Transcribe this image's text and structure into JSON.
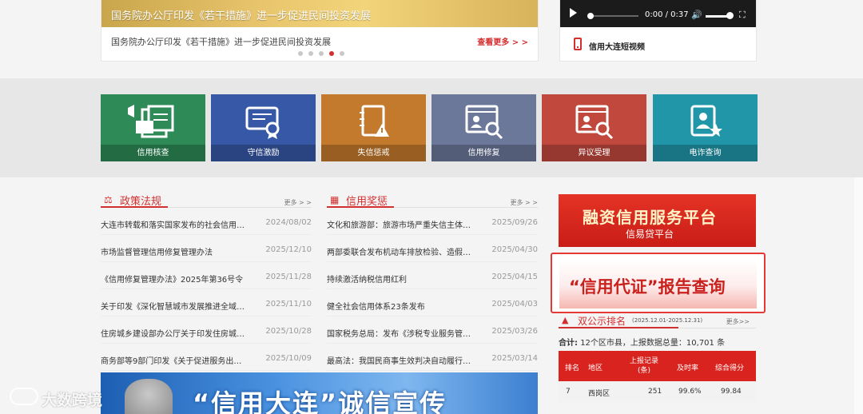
{
  "news": {
    "banner_text": "国务院办公厅印发《若干措施》进一步促进民间投资发展",
    "caption": "国务院办公厅印发《若干措施》进一步促进民间投资发展",
    "more": "查看更多 > >",
    "dots_total": 5,
    "active_dot": 4
  },
  "video": {
    "time": "0:00 / 0:37",
    "label": "信用大连短视频"
  },
  "tiles": [
    {
      "label": "信用核查",
      "color": "#2e8b57",
      "icon": "megaphone-document-icon"
    },
    {
      "label": "守信激励",
      "color": "#3658a6",
      "icon": "certificate-award-icon"
    },
    {
      "label": "失信惩戒",
      "color": "#c47a2c",
      "icon": "notebook-warning-icon"
    },
    {
      "label": "信用修复",
      "color": "#6b789a",
      "icon": "browser-search-user-icon"
    },
    {
      "label": "异议受理",
      "color": "#c0483d",
      "icon": "browser-search-user-icon"
    },
    {
      "label": "电诈查询",
      "color": "#2196a8",
      "icon": "user-document-star-icon"
    }
  ],
  "policy": {
    "title": "政策法规",
    "more": "更多 > >",
    "items": [
      {
        "title": "大连市转载和落实国家发布的社会信用体...",
        "date": "2024/08/02"
      },
      {
        "title": "市场监督管理信用修复管理办法",
        "date": "2025/12/10"
      },
      {
        "title": "《信用修复管理办法》2025年第36号令",
        "date": "2025/11/28"
      },
      {
        "title": "关于印发《深化智慧城市发展推进全域数...",
        "date": "2025/11/10"
      },
      {
        "title": "住房城乡建设部办公厅关于印发住房城乡...",
        "date": "2025/10/28"
      },
      {
        "title": "商务部等9部门印发《关于促进服务出口的...",
        "date": "2025/10/09"
      }
    ]
  },
  "awards": {
    "title": "信用奖惩",
    "more": "更多 > >",
    "items": [
      {
        "title": "文化和旅游部：旅游市场严重失信主体典...",
        "date": "2025/09/26"
      },
      {
        "title": "两部委联合发布机动车排放检验、造假情...",
        "date": "2025/04/30"
      },
      {
        "title": "持续激活纳税信用红利",
        "date": "2025/04/15"
      },
      {
        "title": "健全社会信用体系23条发布",
        "date": "2025/04/03"
      },
      {
        "title": "国家税务总局：发布《涉税专业服务管理...",
        "date": "2025/03/26"
      },
      {
        "title": "最高法：我国民商事生效判决自动履行率...",
        "date": "2025/03/14"
      }
    ]
  },
  "ads": {
    "ad1_title": "融资信用服务平台",
    "ad1_sub": "信易贷平台",
    "ad2_title": "“信用代证”报告查询"
  },
  "ranking": {
    "title": "双公示排名",
    "range": "(2025.12.01-2025.12.31)",
    "more": "更多>>",
    "summary_label": "合计:",
    "summary_text": "12个区市县，上报数据总量：10,701 条",
    "headers": {
      "rank": "排名",
      "area": "地区",
      "count_line1": "上报记录",
      "count_line2": "(条)",
      "timely": "及时率",
      "score": "综合得分"
    },
    "rows": [
      {
        "rank": "7",
        "area": "西岗区",
        "count": "251",
        "timely": "99.6%",
        "score": "99.84"
      }
    ]
  },
  "bottom_banner": {
    "text": "“信用大连”诚信宣传"
  },
  "watermark": {
    "text": "大数跨境"
  },
  "colors": {
    "accent": "#d32f2f"
  }
}
